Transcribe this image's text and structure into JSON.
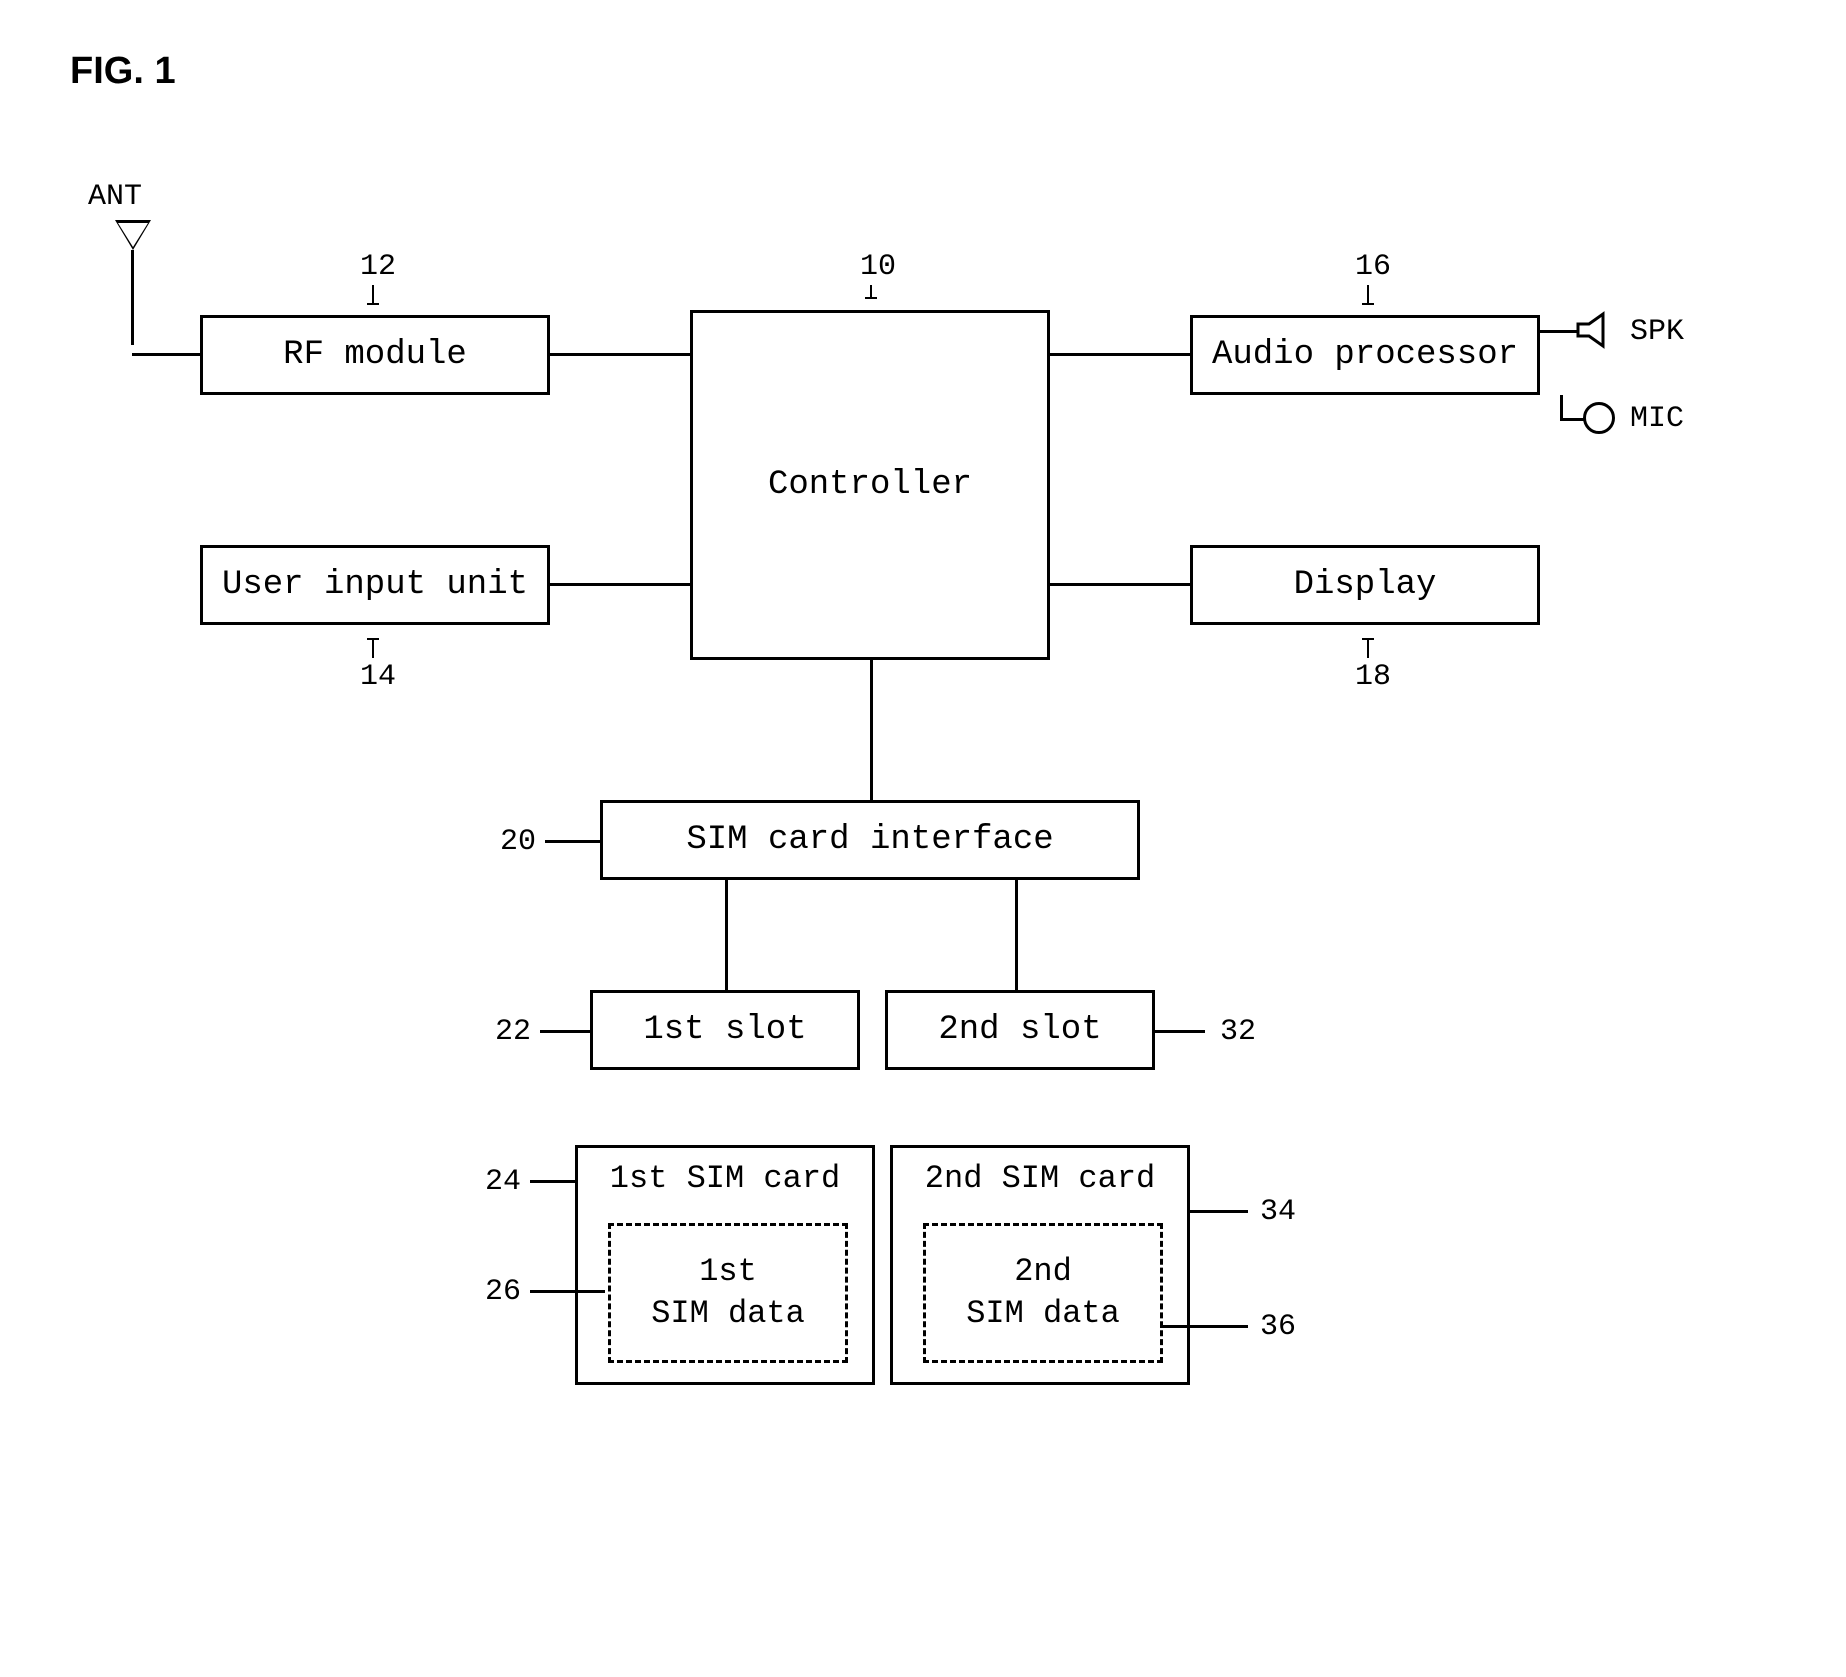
{
  "figure_label": "FIG. 1",
  "blocks": {
    "controller": {
      "label": "Controller",
      "ref": "10"
    },
    "rf_module": {
      "label": "RF module",
      "ref": "12"
    },
    "user_input": {
      "label": "User input unit",
      "ref": "14"
    },
    "audio_proc": {
      "label": "Audio processor",
      "ref": "16"
    },
    "display": {
      "label": "Display",
      "ref": "18"
    },
    "sim_interface": {
      "label": "SIM card interface",
      "ref": "20"
    },
    "slot1": {
      "label": "1st slot",
      "ref": "22"
    },
    "slot2": {
      "label": "2nd slot",
      "ref": "32"
    },
    "sim1": {
      "label": "1st SIM card",
      "ref": "24"
    },
    "sim1_data": {
      "label": "1st\nSIM data",
      "ref": "26"
    },
    "sim2": {
      "label": "2nd SIM card",
      "ref": "34"
    },
    "sim2_data": {
      "label": "2nd\nSIM data",
      "ref": "36"
    }
  },
  "io": {
    "antenna": "ANT",
    "speaker": "SPK",
    "mic": "MIC"
  }
}
